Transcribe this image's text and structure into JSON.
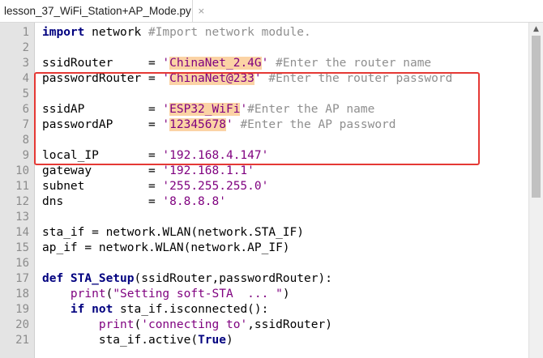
{
  "tab": {
    "filename": "lesson_37_WiFi_Station+AP_Mode.py",
    "close_glyph": "×"
  },
  "line_numbers": [
    "1",
    "2",
    "3",
    "4",
    "5",
    "6",
    "7",
    "8",
    "9",
    "10",
    "11",
    "12",
    "13",
    "14",
    "15",
    "16",
    "17",
    "18",
    "19",
    "20",
    "21"
  ],
  "code": {
    "l1": {
      "kw": "import",
      "rest": " network ",
      "comment": "#Import network module."
    },
    "l3": {
      "name": "ssidRouter     = ",
      "q1": "'",
      "val": "ChinaNet_2.4G",
      "q2": "'",
      "comment": " #Enter the router name"
    },
    "l4": {
      "name": "passwordRouter = ",
      "q1": "'",
      "val": "ChinaNet@233",
      "q2": "'",
      "comment": " #Enter the router password"
    },
    "l6": {
      "name": "ssidAP         = ",
      "q1": "'",
      "val": "ESP32_WiFi",
      "q2": "'",
      "comment": "#Enter the AP name"
    },
    "l7": {
      "name": "passwordAP     = ",
      "q1": "'",
      "val": "12345678",
      "q2": "'",
      "comment": " #Enter the AP password"
    },
    "l9": {
      "name": "local_IP       = ",
      "val": "'192.168.4.147'"
    },
    "l10": {
      "name": "gateway        = ",
      "val": "'192.168.1.1'"
    },
    "l11": {
      "name": "subnet         = ",
      "val": "'255.255.255.0'"
    },
    "l12": {
      "name": "dns            = ",
      "val": "'8.8.8.8'"
    },
    "l14": {
      "text": "sta_if = network.WLAN(network.STA_IF)"
    },
    "l15": {
      "text": "ap_if = network.WLAN(network.AP_IF)"
    },
    "l17": {
      "kw": "def",
      "fname": " STA_Setup",
      "rest": "(ssidRouter,passwordRouter):"
    },
    "l18": {
      "indent": "    ",
      "fn": "print",
      "open": "(",
      "str": "\"Setting soft-STA  ... \"",
      "close": ")"
    },
    "l19": {
      "indent": "    ",
      "kw1": "if",
      "kw2": " not",
      "rest": " sta_if.isconnected():"
    },
    "l20": {
      "indent": "        ",
      "fn": "print",
      "open": "(",
      "str": "'connecting to'",
      "rest": ",ssidRouter)"
    },
    "l21": {
      "indent": "        ",
      "pre": "sta_if.active(",
      "kw": "True",
      "post": ")"
    }
  },
  "colors": {
    "highlight": "#fbd3a5",
    "annotation_box": "#e53935",
    "keyword": "#00007f",
    "string": "#7f007f",
    "comment": "#8f8f8f"
  }
}
